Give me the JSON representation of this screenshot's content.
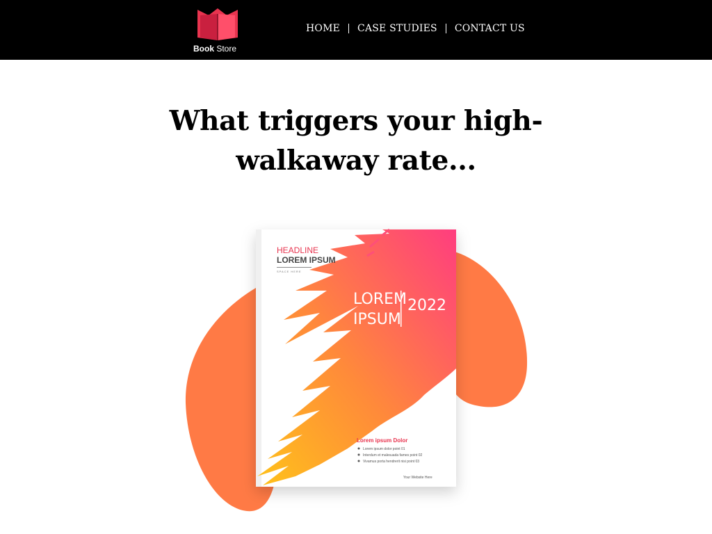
{
  "brand": {
    "logo_text_bold": "Book",
    "logo_text_regular": " Store",
    "colors": {
      "navbar": "#000000",
      "logo_red": "#e8344f"
    }
  },
  "nav": {
    "items": [
      {
        "label": "HOME"
      },
      {
        "label": "CASE STUDIES"
      },
      {
        "label": "CONTACT US"
      }
    ]
  },
  "hero": {
    "headline_line1": "What triggers your high-",
    "headline_line2": "walkaway rate..."
  },
  "book": {
    "headline_small": "HEADLINE",
    "headline_big": "LOREM IPSUM",
    "space_here": "SPACE HERE",
    "title_line1": "LOREM",
    "title_line2": "IPSUM",
    "year": "2022",
    "list_title": "Lorem ipsum Dolor",
    "points": [
      "Lorem ipsum dolor point 01",
      "Interdum et malesuada fames point 02",
      "Vivamus porta hendrerit nisi point 03"
    ],
    "website": "Your Website Here",
    "colors": {
      "accent_pink": "#ff3d7f",
      "accent_orange": "#ff7a45",
      "accent_yellow": "#ffc21a",
      "blob": "#ff7a45"
    }
  }
}
